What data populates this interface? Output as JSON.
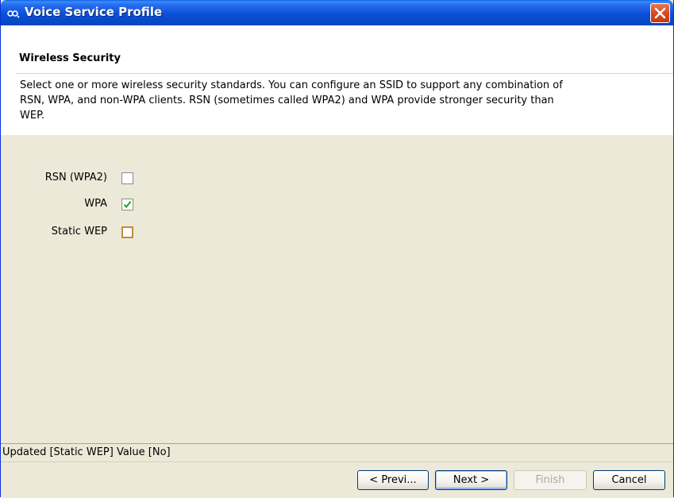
{
  "window": {
    "title": "Voice Service Profile"
  },
  "header": {
    "title": "Wireless Security",
    "description": "Select one or more wireless security standards. You can configure an SSID to support any combination of RSN, WPA, and non-WPA clients. RSN (sometimes called WPA2) and WPA provide stronger security than WEP."
  },
  "options": [
    {
      "label": "RSN (WPA2)",
      "checked": false
    },
    {
      "label": "WPA",
      "checked": true
    },
    {
      "label": "Static WEP",
      "checked": false,
      "focused": true
    }
  ],
  "status": {
    "text": "Updated [Static WEP] Value [No]"
  },
  "buttons": {
    "previous": "< Previ...",
    "next": "Next >",
    "finish": "Finish",
    "cancel": "Cancel"
  },
  "colors": {
    "titlebar": "#0a50d8",
    "close": "#d84a20",
    "checkmark": "#21a121",
    "focus_border": "#c8883a"
  }
}
